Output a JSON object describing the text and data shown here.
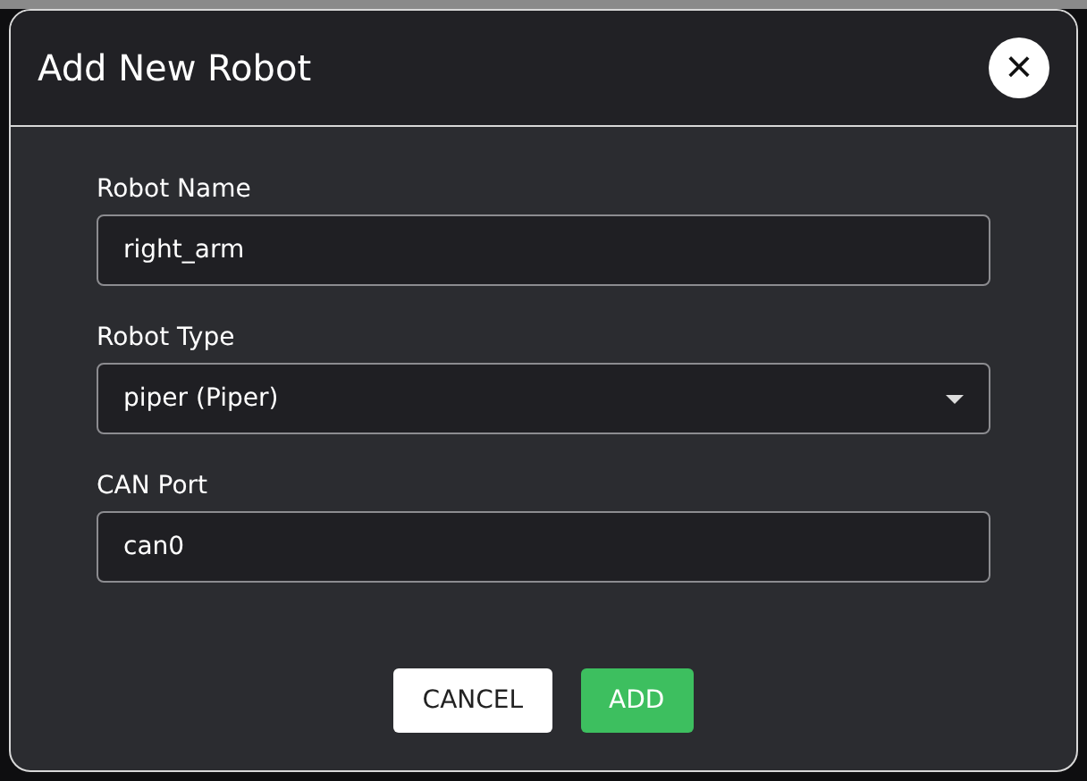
{
  "dialog": {
    "title": "Add New Robot",
    "close_symbol": "×"
  },
  "fields": [
    {
      "kind": "text",
      "label": "Robot Name",
      "value": "right_arm"
    },
    {
      "kind": "select",
      "label": "Robot Type",
      "value": "piper (Piper)"
    },
    {
      "kind": "text",
      "label": "CAN Port",
      "value": "can0"
    }
  ],
  "buttons": [
    {
      "kind": "secondary",
      "label": "CANCEL"
    },
    {
      "kind": "primary",
      "label": "ADD"
    }
  ]
}
